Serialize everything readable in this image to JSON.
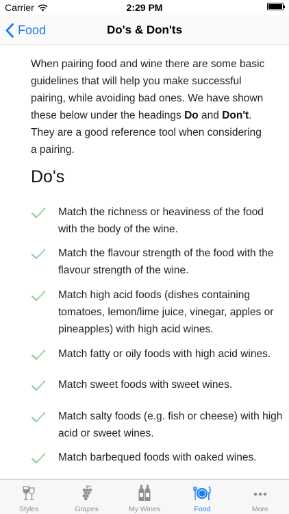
{
  "status": {
    "carrier": "Carrier",
    "time": "2:29 PM"
  },
  "nav": {
    "back_label": "Food",
    "title": "Do's & Don'ts"
  },
  "intro": {
    "part1": "When pairing food and wine there are some basic guidelines that will help you make successful pairing, while avoiding bad ones. We have shown these below under the headings ",
    "do_word": "Do",
    "part2": " and ",
    "dont_word": "Don't",
    "part3": ". They are a good reference tool when considering a pairing."
  },
  "dos": {
    "heading": "Do's",
    "items": [
      "Match the richness or heaviness of the food with the body of the wine.",
      "Match the flavour strength of the food with the flavour strength of the wine.",
      "Match high acid foods (dishes containing tomatoes, lemon/lime juice, vinegar, apples or pineapples) with high acid wines.",
      "Match fatty or oily foods with high acid wines.",
      "Match sweet foods with sweet wines.",
      "Match salty foods (e.g. fish or cheese) with high acid or sweet wines.",
      "Match barbequed foods with oaked wines."
    ]
  },
  "tabs": [
    {
      "label": "Styles",
      "icon": "wine-glasses-icon",
      "active": false
    },
    {
      "label": "Grapes",
      "icon": "grapes-icon",
      "active": false
    },
    {
      "label": "My Wines",
      "icon": "wine-bottles-icon",
      "active": false
    },
    {
      "label": "Food",
      "icon": "plate-cutlery-icon",
      "active": true
    },
    {
      "label": "More",
      "icon": "more-dots-icon",
      "active": false
    }
  ],
  "colors": {
    "accent": "#1a7cf5",
    "check": "#8fc79a",
    "inactive": "#8e8e93"
  }
}
